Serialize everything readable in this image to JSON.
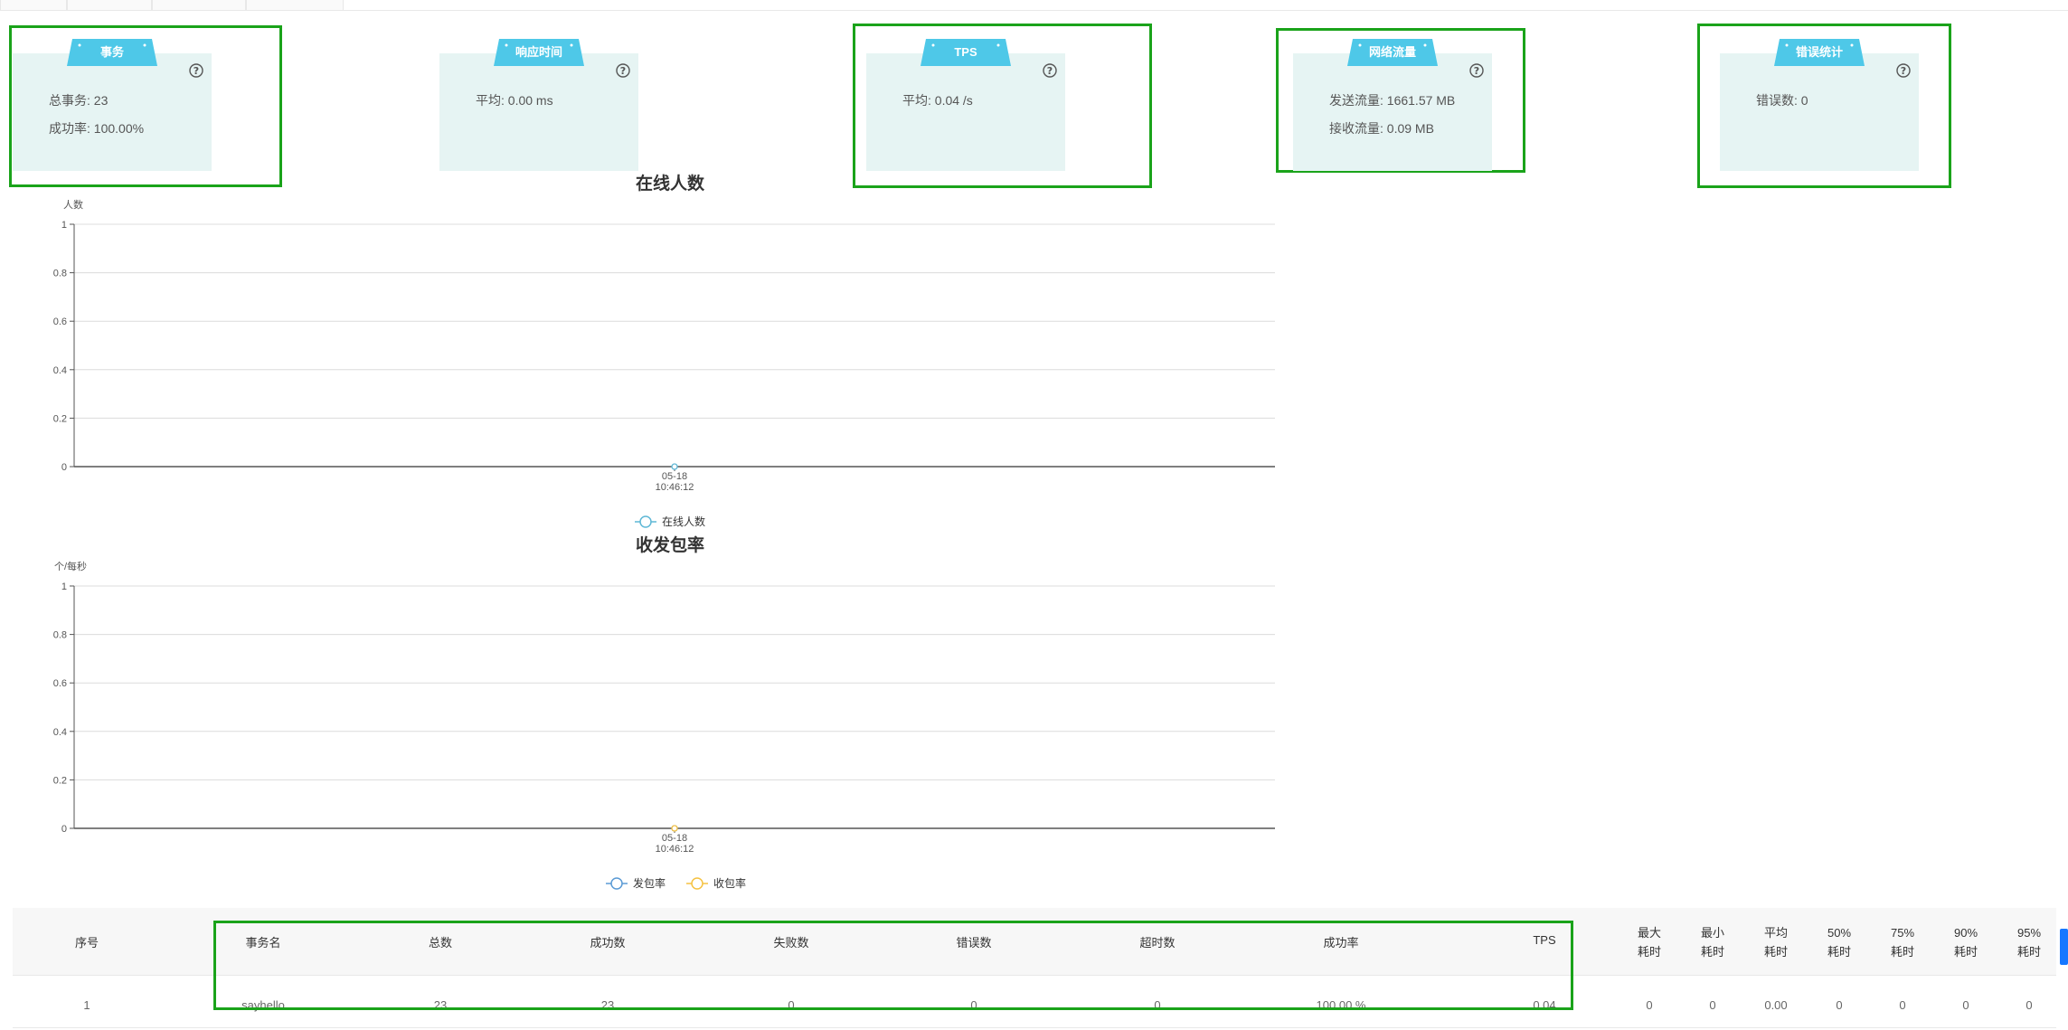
{
  "colors": {
    "accent_badge": "#4ec8e8",
    "card_bg": "#e6f4f3",
    "highlight_frame": "#1aa31a",
    "series_send": "#5b9bd5",
    "series_recv": "#f5c242",
    "series_online": "#5fb8d6",
    "scroll_handle": "#1677ff"
  },
  "cards": [
    {
      "title": "事务",
      "lines": [
        "总事务: 23",
        "成功率: 100.00%"
      ],
      "icon": "question-circle-icon"
    },
    {
      "title": "响应时间",
      "lines": [
        "平均: 0.00 ms"
      ],
      "icon": "question-circle-icon"
    },
    {
      "title": "TPS",
      "lines": [
        "平均: 0.04 /s"
      ],
      "icon": "question-circle-icon"
    },
    {
      "title": "网络流量",
      "lines": [
        "发送流量: 1661.57 MB",
        "接收流量: 0.09 MB"
      ],
      "icon": "question-circle-icon"
    },
    {
      "title": "错误统计",
      "lines": [
        "错误数: 0"
      ],
      "icon": "question-circle-icon"
    }
  ],
  "chart_data": [
    {
      "type": "line",
      "title": "在线人数",
      "ylabel": "人数",
      "xlabel": "",
      "ylim": [
        0,
        1
      ],
      "yticks": [
        "0",
        "0.2",
        "0.4",
        "0.6",
        "0.8",
        "1"
      ],
      "x": [
        "05-18 10:46:12"
      ],
      "x_label_lines": [
        "05-18",
        "10:46:12"
      ],
      "series": [
        {
          "name": "在线人数",
          "values": [
            0
          ]
        }
      ],
      "grid": true,
      "legend": "bottom-center"
    },
    {
      "type": "line",
      "title": "收发包率",
      "ylabel": "个/每秒",
      "xlabel": "",
      "ylim": [
        0,
        1
      ],
      "yticks": [
        "0",
        "0.2",
        "0.4",
        "0.6",
        "0.8",
        "1"
      ],
      "x": [
        "05-18 10:46:12"
      ],
      "x_label_lines": [
        "05-18",
        "10:46:12"
      ],
      "series": [
        {
          "name": "发包率",
          "values": [
            0
          ]
        },
        {
          "name": "收包率",
          "values": [
            0
          ]
        }
      ],
      "grid": true,
      "legend": "bottom-center"
    }
  ],
  "table": {
    "headers": [
      [
        "序号"
      ],
      [
        "事务名"
      ],
      [
        "总数"
      ],
      [
        "成功数"
      ],
      [
        "失败数"
      ],
      [
        "错误数"
      ],
      [
        "超时数"
      ],
      [
        "成功率"
      ],
      [
        "TPS"
      ],
      [
        "最大",
        "耗时"
      ],
      [
        "最小",
        "耗时"
      ],
      [
        "平均",
        "耗时"
      ],
      [
        "50%",
        "耗时"
      ],
      [
        "75%",
        "耗时"
      ],
      [
        "90%",
        "耗时"
      ],
      [
        "95%",
        "耗时"
      ]
    ],
    "rows": [
      [
        "1",
        "sayhello",
        "23",
        "23",
        "0",
        "0",
        "0",
        "100.00 %",
        "0.04",
        "0",
        "0",
        "0.00",
        "0",
        "0",
        "0",
        "0"
      ]
    ]
  }
}
